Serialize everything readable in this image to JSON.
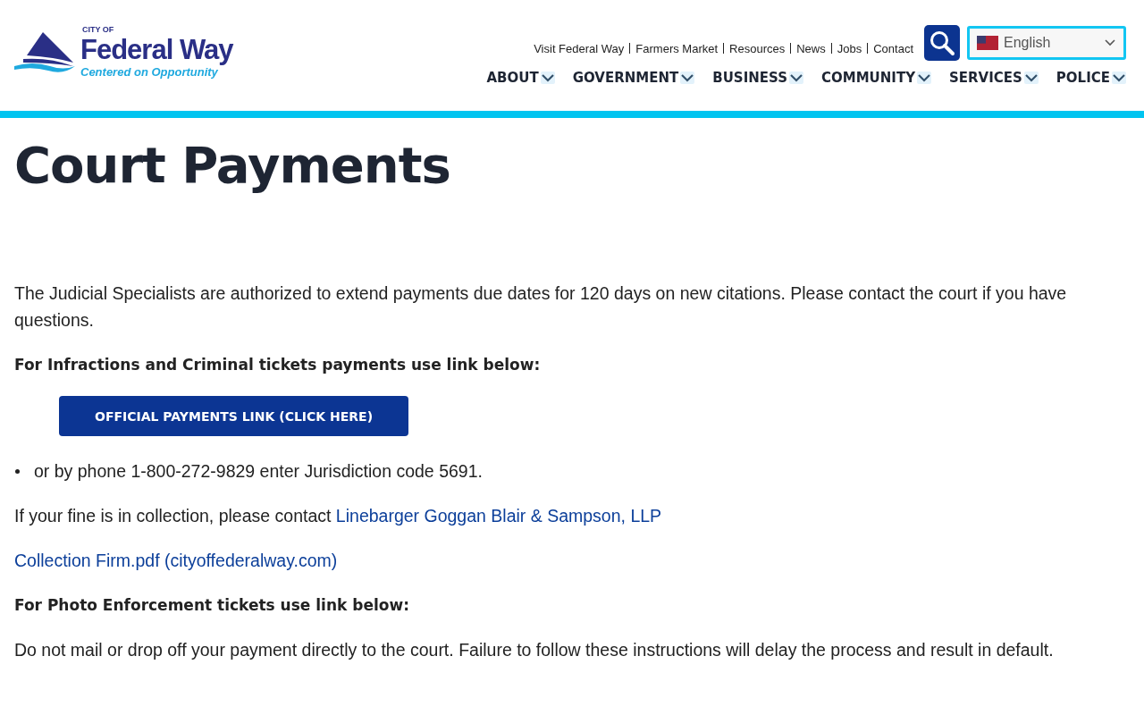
{
  "logo": {
    "top": "CITY OF",
    "name": "Federal Way",
    "tagline": "Centered on Opportunity"
  },
  "utility_links": [
    "Visit Federal Way",
    "Farmers Market",
    "Resources",
    "News",
    "Jobs",
    "Contact"
  ],
  "language_select": {
    "value": "English"
  },
  "nav": [
    "ABOUT",
    "GOVERNMENT",
    "BUSINESS",
    "COMMUNITY",
    "SERVICES",
    "POLICE"
  ],
  "title": "Court Payments",
  "content": [
    {
      "kind": "text",
      "text": "The Judicial Specialists are authorized to extend payments due dates for 120 days on new citations.  Please contact the court if you have questions."
    },
    {
      "kind": "heading",
      "text": "For Infractions and Criminal tickets payments use link below:"
    },
    {
      "kind": "button",
      "text": "OFFICIAL PAYMENTS LINK (CLICK HERE)"
    },
    {
      "kind": "bullet",
      "text": "or by phone 1-800-272-9829  enter Jurisdiction code 5691."
    },
    {
      "kind": "text_link",
      "text": "If your fine is in collection, please contact ",
      "link": "Linebarger Goggan Blair & Sampson, LLP"
    },
    {
      "kind": "link",
      "text": "Collection Firm.pdf (cityoffederalway.com)"
    },
    {
      "kind": "heading",
      "text": "For Photo Enforcement tickets use link below:"
    },
    {
      "kind": "text",
      "text": "Do not mail or drop off your payment directly to the court. Failure to follow these instructions will delay the process and result in default."
    }
  ]
}
